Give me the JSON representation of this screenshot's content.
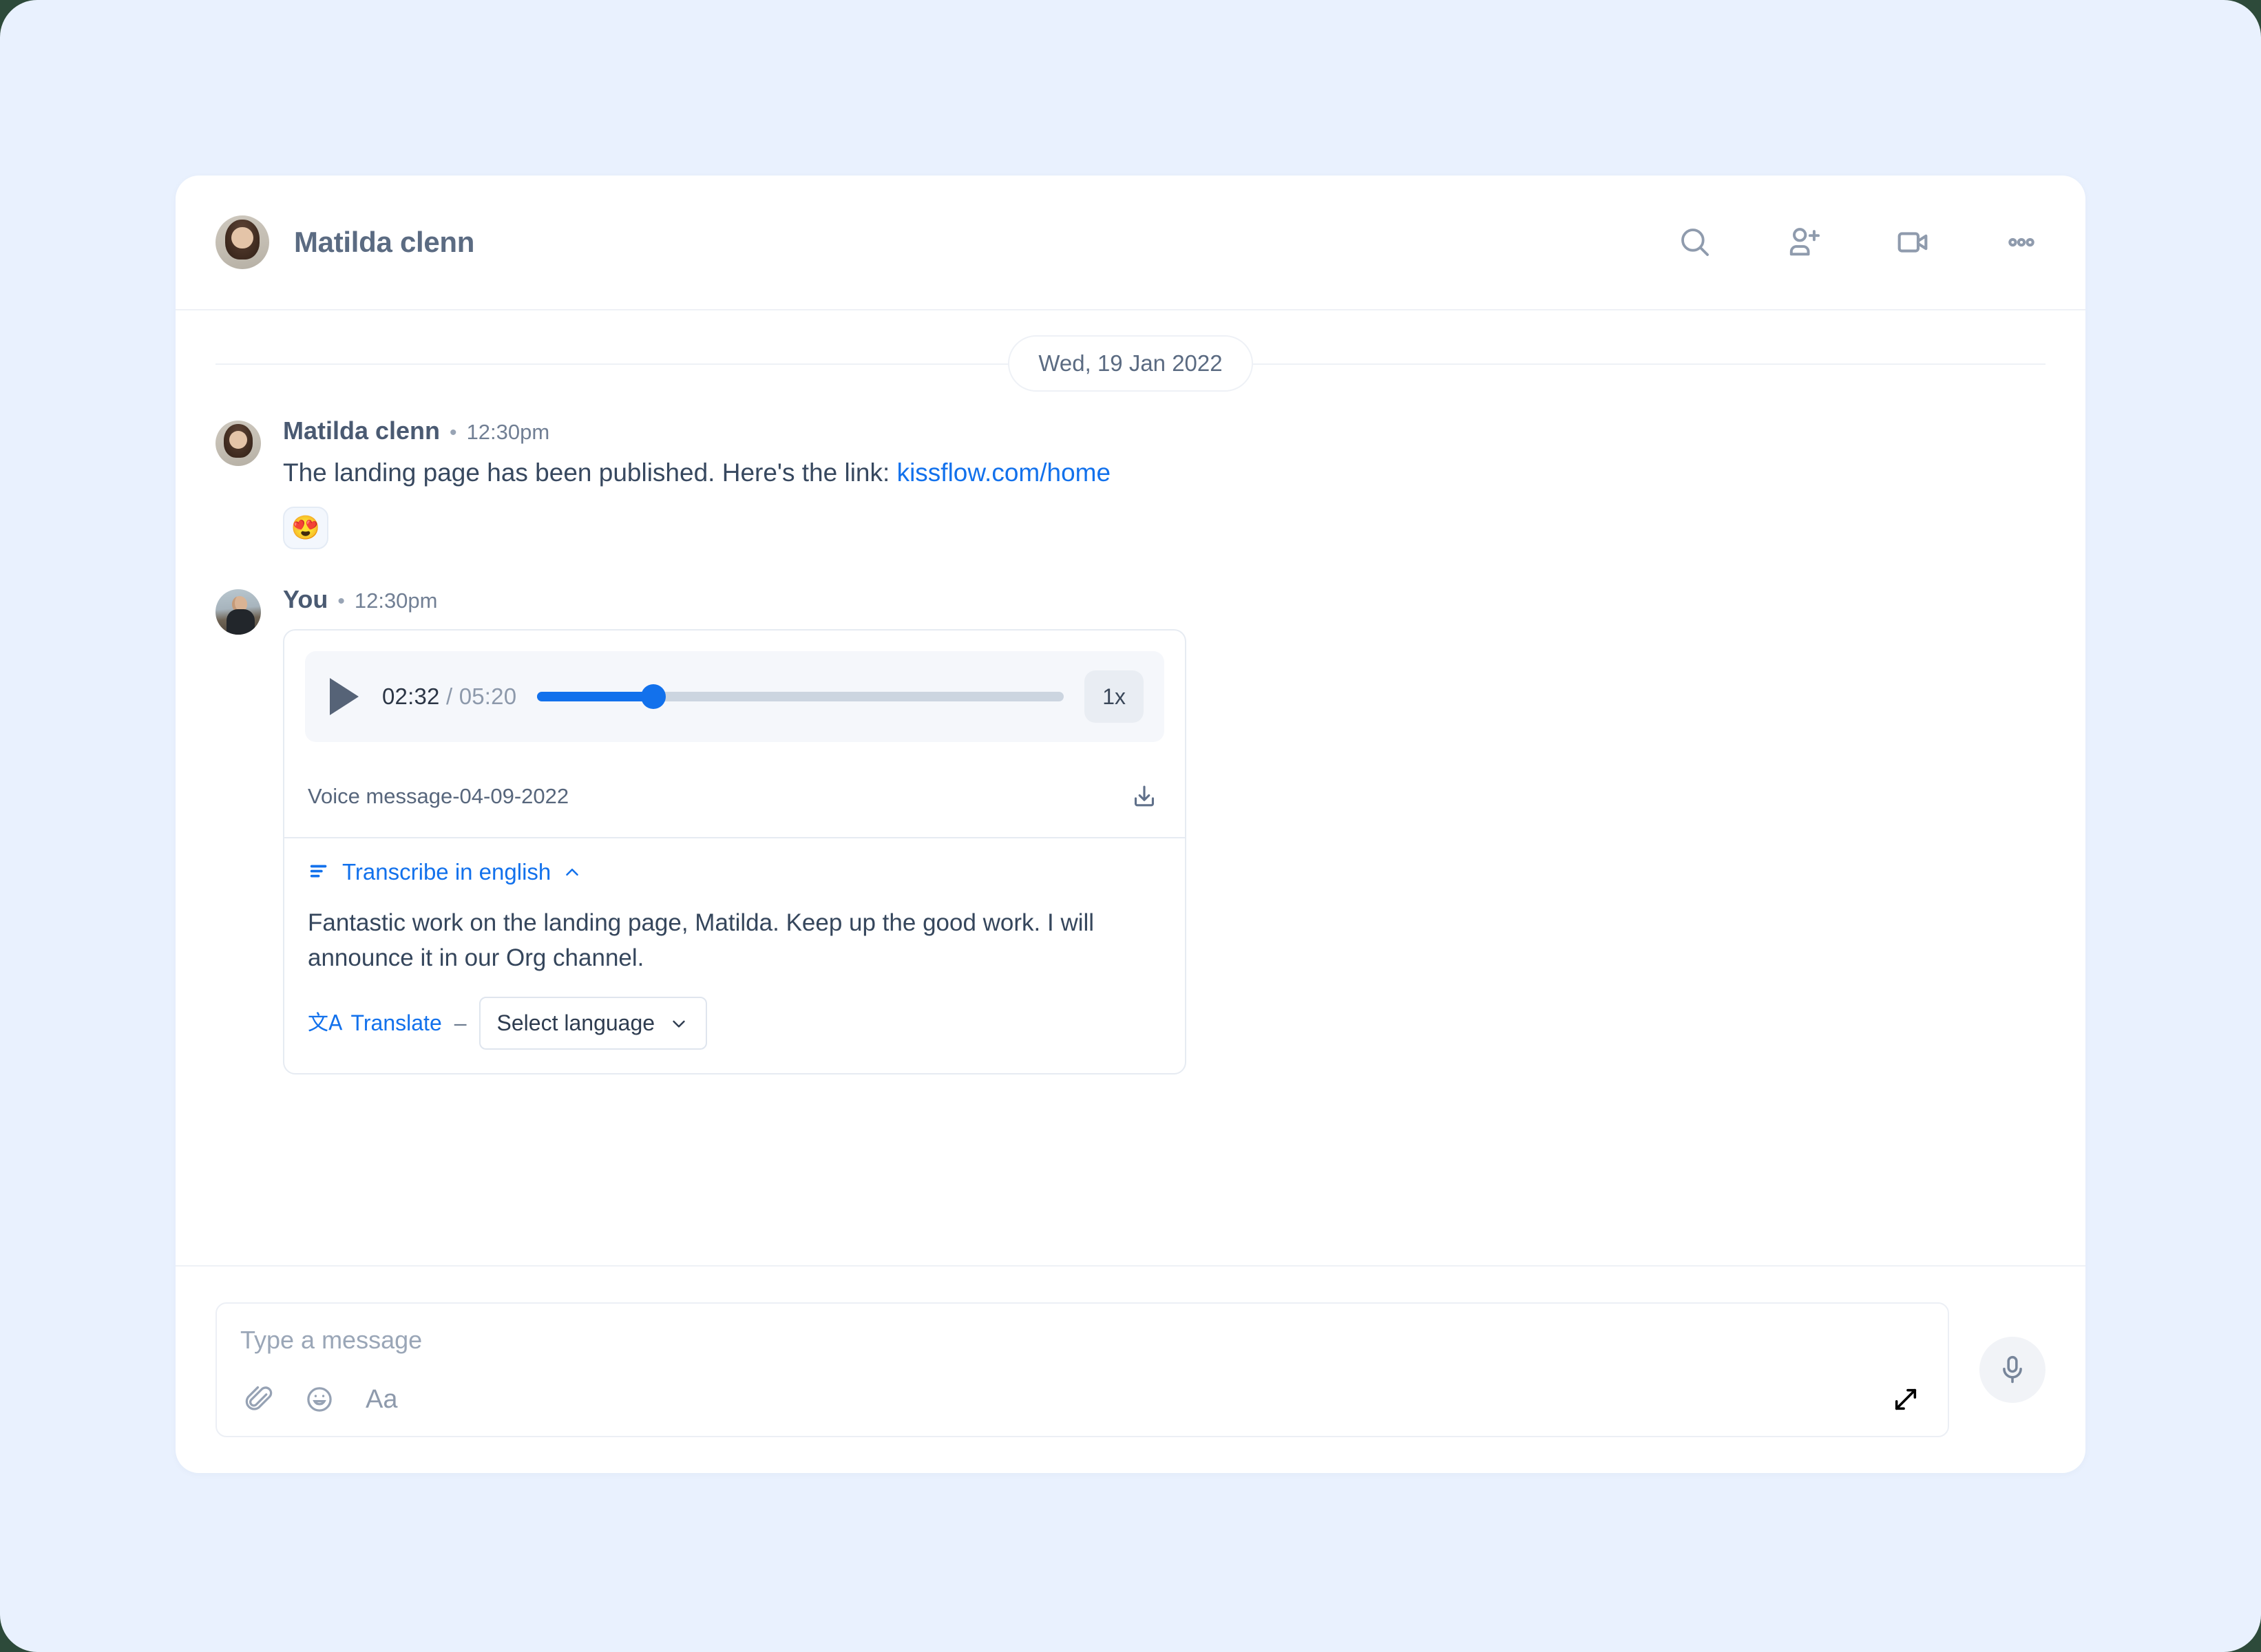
{
  "theme": {
    "page_bg": "#e9f1fe",
    "card_bg": "#ffffff",
    "accent_blue": "#1271ec",
    "text_dark": "#37485f",
    "text_muted": "#717f94",
    "icon_grey": "#8f9bad",
    "track_grey": "#ccd5e0"
  },
  "header": {
    "title": "Matilda clenn",
    "avatar_alt": "Matilda clenn avatar",
    "actions": [
      {
        "name": "search-icon",
        "label": "Search"
      },
      {
        "name": "add-person-icon",
        "label": "Add people"
      },
      {
        "name": "video-call-icon",
        "label": "Video call"
      },
      {
        "name": "more-options-icon",
        "label": "More options"
      }
    ]
  },
  "conversation": {
    "date_divider": "Wed, 19 Jan 2022",
    "messages": [
      {
        "author": "Matilda clenn",
        "separator": "•",
        "time": "12:30pm",
        "text_before_link": "The landing page has been published. Here's the link: ",
        "link_text": "kissflow.com/home",
        "reaction": "😍"
      },
      {
        "author": "You",
        "separator": "•",
        "time": "12:30pm"
      }
    ]
  },
  "voice_message": {
    "player": {
      "play_label": "Play",
      "current_time": "02:32",
      "time_separator": " / ",
      "total_time": "05:20",
      "progress_percent": 22,
      "speed_label": "1x"
    },
    "filename": "Voice message-04-09-2022",
    "download_label": "Download",
    "transcription": {
      "toggle_label": "Transcribe in english",
      "toggle_state": "expanded",
      "text": "Fantastic work on the landing page, Matilda. Keep up the good work. I will announce it in our Org channel.",
      "translate_label": "Translate",
      "translate_glyph": "文A",
      "dash": "–",
      "language_select_value": "Select language"
    }
  },
  "composer": {
    "placeholder": "Type a message",
    "format_label": "Aa",
    "tools": [
      {
        "name": "attachment-icon",
        "label": "Attach file"
      },
      {
        "name": "emoji-icon",
        "label": "Emoji"
      }
    ],
    "expand_label": "Expand",
    "mic_label": "Record voice message"
  }
}
